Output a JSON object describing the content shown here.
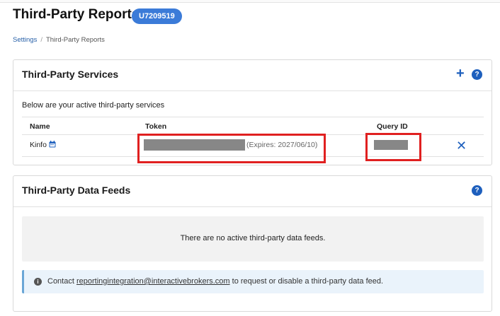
{
  "header": {
    "title": "Third-Party Reports",
    "account_badge": "U7209519"
  },
  "breadcrumb": {
    "items": [
      "Settings",
      "Third-Party Reports"
    ],
    "separator": "/"
  },
  "services_panel": {
    "title": "Third-Party Services",
    "add_icon": "plus-icon",
    "help_icon": "?",
    "intro": "Below are your active third-party services",
    "columns": [
      "Name",
      "Token",
      "Query ID"
    ],
    "rows": [
      {
        "name": "Kinfo",
        "name_icon": "calendar-icon",
        "token": "",
        "token_masked": true,
        "expires": "(Expires: 2027/06/10)",
        "query_id": "",
        "query_id_masked": true,
        "remove_icon": "✕"
      }
    ]
  },
  "feeds_panel": {
    "title": "Third-Party Data Feeds",
    "help_icon": "?",
    "empty_message": "There are no active third-party data feeds.",
    "info": {
      "icon": "i",
      "prefix": "Contact ",
      "email": "reportingintegration@interactivebrokers.com",
      "suffix": " to request or disable a third-party data feed."
    }
  },
  "colors": {
    "accent": "#1d5fbd",
    "badge": "#3b7bd8",
    "highlight": "#e02020",
    "mask": "#878787"
  }
}
